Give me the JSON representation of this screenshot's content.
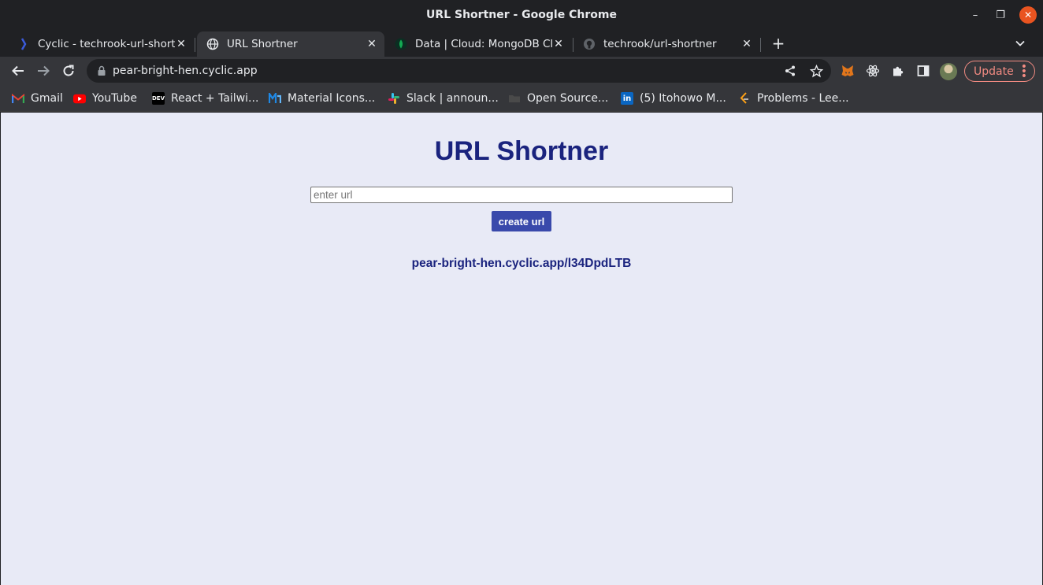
{
  "window": {
    "title": "URL Shortner - Google Chrome",
    "minimize_glyph": "–",
    "maximize_glyph": "❐",
    "close_glyph": "✕"
  },
  "tabs": [
    {
      "label": "Cyclic - techrook-url-short",
      "icon": "cyclic-favicon",
      "active": false
    },
    {
      "label": "URL Shortner",
      "icon": "globe-icon",
      "active": true
    },
    {
      "label": "Data | Cloud: MongoDB Cl",
      "icon": "mongodb-leaf-icon",
      "active": false
    },
    {
      "label": "techrook/url-shortner",
      "icon": "github-icon",
      "active": false
    }
  ],
  "toolbar": {
    "address": "pear-bright-hen.cyclic.app",
    "update_label": "Update"
  },
  "bookmarks": [
    {
      "label": "Gmail",
      "icon": "gmail-icon"
    },
    {
      "label": "YouTube",
      "icon": "youtube-icon"
    },
    {
      "label": "React + Tailwi...",
      "icon": "dev-icon",
      "icon_text": "DEV"
    },
    {
      "label": "Material Icons...",
      "icon": "material-icon"
    },
    {
      "label": "Slack | announ...",
      "icon": "slack-icon"
    },
    {
      "label": "Open Source...",
      "icon": "folder-icon"
    },
    {
      "label": "(5) Itohowo M...",
      "icon": "linkedin-icon",
      "icon_text": "in"
    },
    {
      "label": "Problems - Lee...",
      "icon": "leetcode-icon"
    }
  ],
  "page": {
    "heading": "URL Shortner",
    "input_placeholder": "enter url",
    "input_value": "",
    "button_label": "create url",
    "short_url": "pear-bright-hen.cyclic.app/l34DpdLTB"
  },
  "colors": {
    "page_bg": "#e8eaf6",
    "heading": "#1a237e",
    "button_bg": "#3949ab",
    "chrome_dark": "#202124",
    "chrome_toolbar": "#35363a",
    "update_accent": "#f28b82",
    "close_button": "#e95420"
  }
}
